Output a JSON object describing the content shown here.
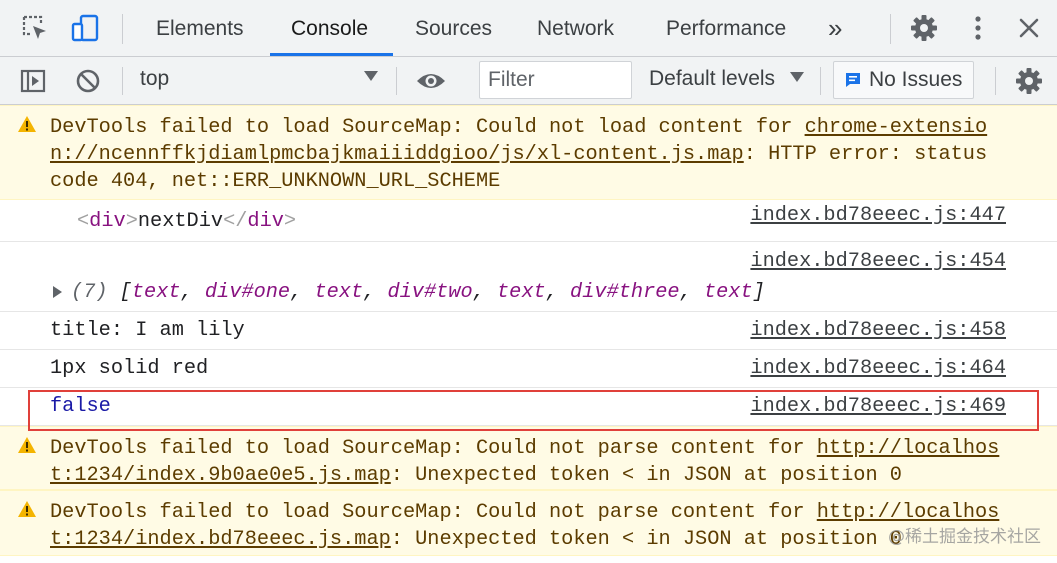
{
  "tabbar": {
    "tabs": [
      {
        "label": "Elements"
      },
      {
        "label": "Console",
        "active": true
      },
      {
        "label": "Sources"
      },
      {
        "label": "Network"
      },
      {
        "label": "Performance"
      }
    ],
    "more_label": "»"
  },
  "toolbar": {
    "context": "top",
    "filter_placeholder": "Filter",
    "levels_label": "Default levels",
    "issues_label": "No Issues"
  },
  "messages": [
    {
      "type": "warning",
      "icon": "warning-icon",
      "lines": [
        {
          "text": "DevTools failed to load SourceMap: Could not load content for ",
          "link": "chrome-extensio"
        },
        {
          "link": "n://ncennffkjdiamlpmcbajkmaiiiddgioo/js/xl-content.js.map",
          "text": ": HTTP error: status"
        },
        {
          "text": "code 404, net::ERR_UNKNOWN_URL_SCHEME"
        }
      ]
    },
    {
      "type": "log",
      "open": "<",
      "tag": "div",
      "close_bracket": ">",
      "content": "nextDiv",
      "end_open": "</",
      "end_tag": "div",
      "end_close": ">",
      "source": "index.bd78eeec.js:447"
    },
    {
      "type": "log-array",
      "source": "index.bd78eeec.js:454",
      "count": "(7)",
      "items": [
        "text",
        "div#one",
        "text",
        "div#two",
        "text",
        "div#three",
        "text"
      ]
    },
    {
      "type": "log",
      "text": "title: I am lily",
      "source": "index.bd78eeec.js:458"
    },
    {
      "type": "log",
      "text": "1px solid red",
      "source": "index.bd78eeec.js:464"
    },
    {
      "type": "log",
      "text": "false",
      "source": "index.bd78eeec.js:469",
      "highlighted": true
    },
    {
      "type": "warning",
      "icon": "warning-icon",
      "lines": [
        {
          "text": "DevTools failed to load SourceMap: Could not parse content for ",
          "link": "http://localhos"
        },
        {
          "link": "t:1234/index.9b0ae0e5.js.map",
          "text": ": Unexpected token < in JSON at position 0"
        }
      ]
    },
    {
      "type": "warning",
      "icon": "warning-icon",
      "lines": [
        {
          "text": "DevTools failed to load SourceMap: Could not parse content for ",
          "link": "http://localhos"
        },
        {
          "link": "t:1234/index.bd78eeec.js.map",
          "text": ": Unexpected token < in JSON at position 0"
        }
      ]
    }
  ],
  "watermark": "@稀土掘金技术社区",
  "colors": {
    "accent": "#1a73e8",
    "warning_bg": "#fffbe5",
    "warning_text": "#5c3c00",
    "highlight_box": "#e0403a"
  }
}
